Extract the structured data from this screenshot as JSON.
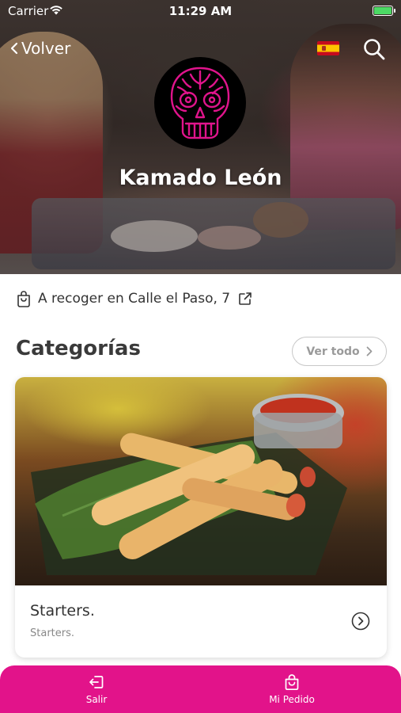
{
  "status_bar": {
    "carrier": "Carrier",
    "time": "11:29 AM",
    "battery_color": "#4cd964"
  },
  "header": {
    "back_label": "Volver",
    "flag": "spain-flag-icon",
    "restaurant_name": "Kamado León",
    "logo": "pink-skull-logo"
  },
  "pickup": {
    "text": "A recoger en Calle el Paso, 7"
  },
  "categories": {
    "title": "Categorías",
    "see_all_label": "Ver todo",
    "items": [
      {
        "name": "Starters.",
        "description": "Starters."
      }
    ]
  },
  "bottom_nav": {
    "color": "#e2138a",
    "items": [
      {
        "label": "Salir",
        "icon": "logout-icon"
      },
      {
        "label": "Mi Pedido",
        "icon": "shopping-bag-icon"
      }
    ]
  }
}
